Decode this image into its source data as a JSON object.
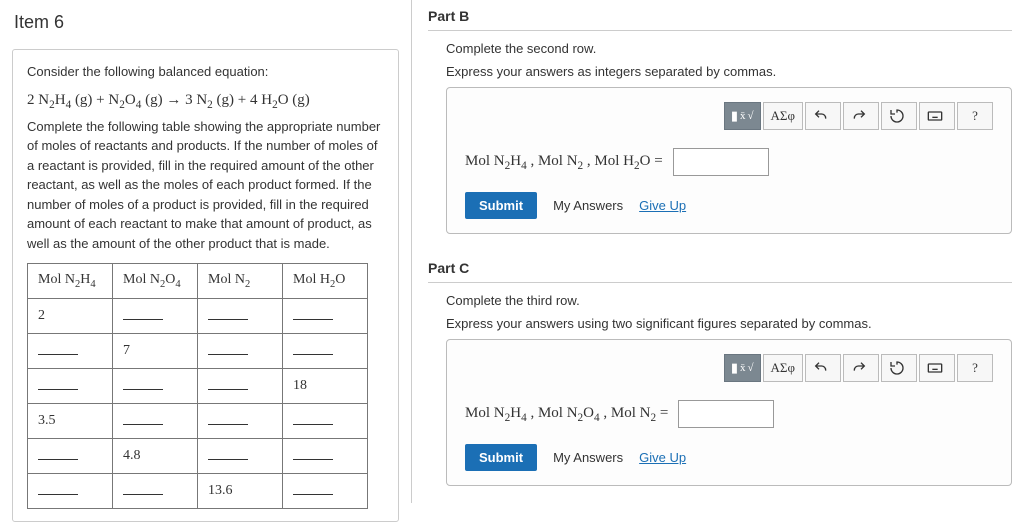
{
  "left": {
    "title": "Item 6",
    "intro": "Consider the following balanced equation:",
    "equation_html": "2 N<sub>2</sub>H<sub>4</sub> (g)  +  N<sub>2</sub>O<sub>4</sub> (g)  →  3 N<sub>2</sub> (g)  +  4 H<sub>2</sub>O (g)",
    "desc": "Complete the following table showing the appropriate number of moles of reactants and products. If the number of moles of a reactant is provided, fill in the required amount of the other reactant, as well as the moles of each product formed. If the number of moles of a product is provided, fill in the required amount of each reactant to make that amount of product, as well as the amount of the other product that is made.",
    "headers_html": [
      "Mol N<sub>2</sub>H<sub>4</sub>",
      "Mol N<sub>2</sub>O<sub>4</sub>",
      "Mol N<sub>2</sub>",
      "Mol H<sub>2</sub>O"
    ],
    "rows": [
      [
        "2",
        "",
        "",
        ""
      ],
      [
        "",
        "7",
        "",
        ""
      ],
      [
        "",
        "",
        "",
        "18"
      ],
      [
        "3.5",
        "",
        "",
        ""
      ],
      [
        "",
        "4.8",
        "",
        ""
      ],
      [
        "",
        "",
        "13.6",
        ""
      ]
    ]
  },
  "partB": {
    "heading": "Part B",
    "line1": "Complete the second row.",
    "line2": "Express your answers as integers separated by commas.",
    "var_html": "Mol N<sub>2</sub>H<sub>4</sub> , Mol N<sub>2</sub> , Mol H<sub>2</sub>O  =",
    "submit": "Submit",
    "my_answers": "My Answers",
    "give_up": "Give Up"
  },
  "partC": {
    "heading": "Part C",
    "line1": "Complete the third row.",
    "line2": "Express your answers using two significant figures separated by commas.",
    "var_html": "Mol N<sub>2</sub>H<sub>4</sub> , Mol N<sub>2</sub>O<sub>4</sub> , Mol N<sub>2</sub>  =",
    "submit": "Submit",
    "my_answers": "My Answers",
    "give_up": "Give Up"
  },
  "toolbar": {
    "greek": "ΑΣφ",
    "help": "?"
  }
}
